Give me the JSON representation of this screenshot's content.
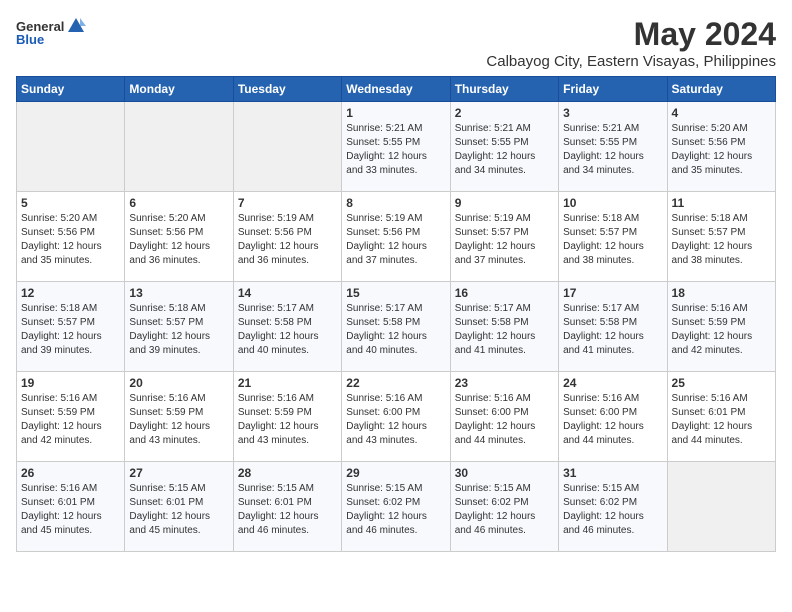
{
  "header": {
    "logo_general": "General",
    "logo_blue": "Blue",
    "month_title": "May 2024",
    "subtitle": "Calbayog City, Eastern Visayas, Philippines"
  },
  "weekdays": [
    "Sunday",
    "Monday",
    "Tuesday",
    "Wednesday",
    "Thursday",
    "Friday",
    "Saturday"
  ],
  "weeks": [
    [
      {
        "day": "",
        "info": ""
      },
      {
        "day": "",
        "info": ""
      },
      {
        "day": "",
        "info": ""
      },
      {
        "day": "1",
        "info": "Sunrise: 5:21 AM\nSunset: 5:55 PM\nDaylight: 12 hours\nand 33 minutes."
      },
      {
        "day": "2",
        "info": "Sunrise: 5:21 AM\nSunset: 5:55 PM\nDaylight: 12 hours\nand 34 minutes."
      },
      {
        "day": "3",
        "info": "Sunrise: 5:21 AM\nSunset: 5:55 PM\nDaylight: 12 hours\nand 34 minutes."
      },
      {
        "day": "4",
        "info": "Sunrise: 5:20 AM\nSunset: 5:56 PM\nDaylight: 12 hours\nand 35 minutes."
      }
    ],
    [
      {
        "day": "5",
        "info": "Sunrise: 5:20 AM\nSunset: 5:56 PM\nDaylight: 12 hours\nand 35 minutes."
      },
      {
        "day": "6",
        "info": "Sunrise: 5:20 AM\nSunset: 5:56 PM\nDaylight: 12 hours\nand 36 minutes."
      },
      {
        "day": "7",
        "info": "Sunrise: 5:19 AM\nSunset: 5:56 PM\nDaylight: 12 hours\nand 36 minutes."
      },
      {
        "day": "8",
        "info": "Sunrise: 5:19 AM\nSunset: 5:56 PM\nDaylight: 12 hours\nand 37 minutes."
      },
      {
        "day": "9",
        "info": "Sunrise: 5:19 AM\nSunset: 5:57 PM\nDaylight: 12 hours\nand 37 minutes."
      },
      {
        "day": "10",
        "info": "Sunrise: 5:18 AM\nSunset: 5:57 PM\nDaylight: 12 hours\nand 38 minutes."
      },
      {
        "day": "11",
        "info": "Sunrise: 5:18 AM\nSunset: 5:57 PM\nDaylight: 12 hours\nand 38 minutes."
      }
    ],
    [
      {
        "day": "12",
        "info": "Sunrise: 5:18 AM\nSunset: 5:57 PM\nDaylight: 12 hours\nand 39 minutes."
      },
      {
        "day": "13",
        "info": "Sunrise: 5:18 AM\nSunset: 5:57 PM\nDaylight: 12 hours\nand 39 minutes."
      },
      {
        "day": "14",
        "info": "Sunrise: 5:17 AM\nSunset: 5:58 PM\nDaylight: 12 hours\nand 40 minutes."
      },
      {
        "day": "15",
        "info": "Sunrise: 5:17 AM\nSunset: 5:58 PM\nDaylight: 12 hours\nand 40 minutes."
      },
      {
        "day": "16",
        "info": "Sunrise: 5:17 AM\nSunset: 5:58 PM\nDaylight: 12 hours\nand 41 minutes."
      },
      {
        "day": "17",
        "info": "Sunrise: 5:17 AM\nSunset: 5:58 PM\nDaylight: 12 hours\nand 41 minutes."
      },
      {
        "day": "18",
        "info": "Sunrise: 5:16 AM\nSunset: 5:59 PM\nDaylight: 12 hours\nand 42 minutes."
      }
    ],
    [
      {
        "day": "19",
        "info": "Sunrise: 5:16 AM\nSunset: 5:59 PM\nDaylight: 12 hours\nand 42 minutes."
      },
      {
        "day": "20",
        "info": "Sunrise: 5:16 AM\nSunset: 5:59 PM\nDaylight: 12 hours\nand 43 minutes."
      },
      {
        "day": "21",
        "info": "Sunrise: 5:16 AM\nSunset: 5:59 PM\nDaylight: 12 hours\nand 43 minutes."
      },
      {
        "day": "22",
        "info": "Sunrise: 5:16 AM\nSunset: 6:00 PM\nDaylight: 12 hours\nand 43 minutes."
      },
      {
        "day": "23",
        "info": "Sunrise: 5:16 AM\nSunset: 6:00 PM\nDaylight: 12 hours\nand 44 minutes."
      },
      {
        "day": "24",
        "info": "Sunrise: 5:16 AM\nSunset: 6:00 PM\nDaylight: 12 hours\nand 44 minutes."
      },
      {
        "day": "25",
        "info": "Sunrise: 5:16 AM\nSunset: 6:01 PM\nDaylight: 12 hours\nand 44 minutes."
      }
    ],
    [
      {
        "day": "26",
        "info": "Sunrise: 5:16 AM\nSunset: 6:01 PM\nDaylight: 12 hours\nand 45 minutes."
      },
      {
        "day": "27",
        "info": "Sunrise: 5:15 AM\nSunset: 6:01 PM\nDaylight: 12 hours\nand 45 minutes."
      },
      {
        "day": "28",
        "info": "Sunrise: 5:15 AM\nSunset: 6:01 PM\nDaylight: 12 hours\nand 46 minutes."
      },
      {
        "day": "29",
        "info": "Sunrise: 5:15 AM\nSunset: 6:02 PM\nDaylight: 12 hours\nand 46 minutes."
      },
      {
        "day": "30",
        "info": "Sunrise: 5:15 AM\nSunset: 6:02 PM\nDaylight: 12 hours\nand 46 minutes."
      },
      {
        "day": "31",
        "info": "Sunrise: 5:15 AM\nSunset: 6:02 PM\nDaylight: 12 hours\nand 46 minutes."
      },
      {
        "day": "",
        "info": ""
      }
    ]
  ]
}
